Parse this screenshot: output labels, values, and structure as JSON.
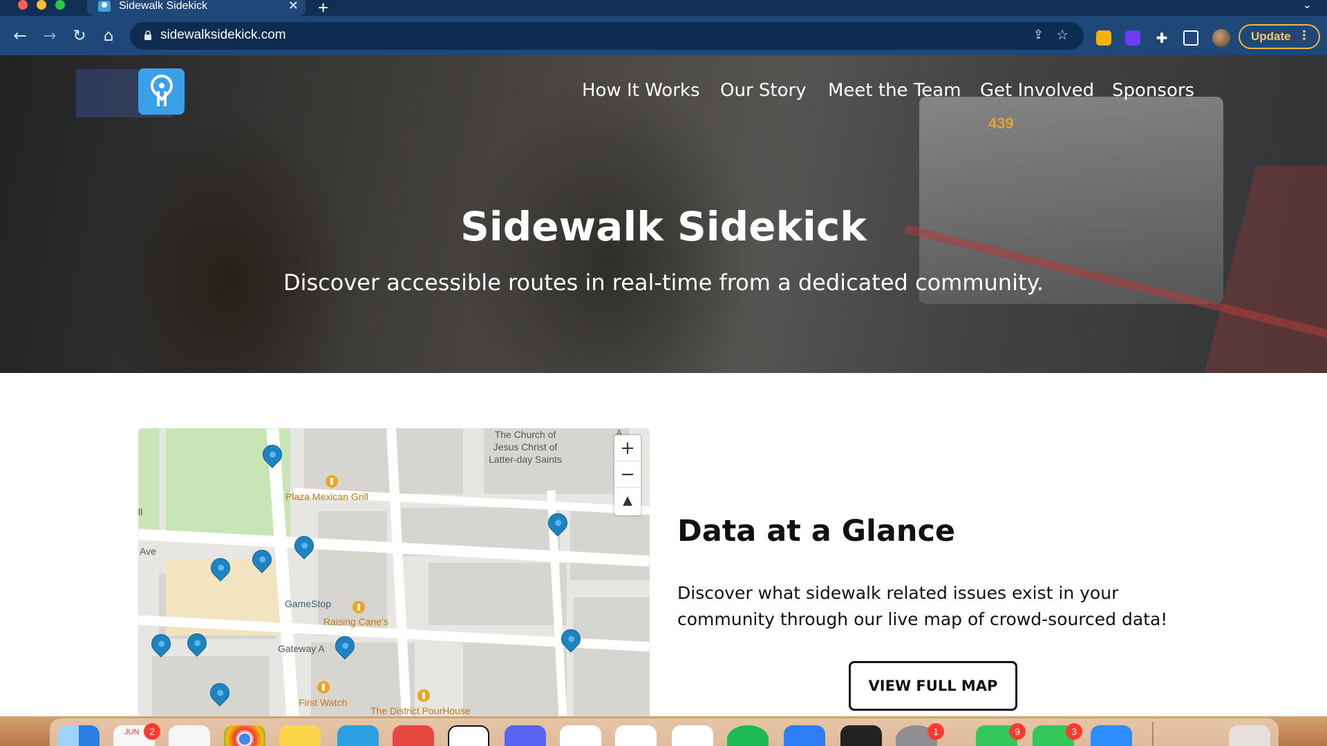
{
  "browser": {
    "tab_title": "Sidewalk Sidekick",
    "tab_close": "✕",
    "new_tab": "+",
    "url": "sidewalksidekick.com",
    "update_label": "Update",
    "update_menu": "⋮"
  },
  "site": {
    "nav": [
      "How It Works",
      "Our Story",
      "Meet the Team",
      "Get Involved",
      "Sponsors"
    ],
    "hero_title": "Sidewalk Sidekick",
    "hero_subtitle": "Discover accessible routes in real-time from a dedicated community.",
    "hero_bus_number": "439"
  },
  "map": {
    "labels": {
      "church": "The Church of\nJesus Christ of\nLatter-day Saints",
      "plaza": "Plaza Mexican Grill",
      "ave": "Ave",
      "gamestop": "GameStop",
      "raising": "Raising Cane's",
      "gateway": "Gateway A",
      "firstwatch": "First Watch",
      "pourhouse": "The District PourHouse",
      "ll": "ll"
    },
    "controls": {
      "zoom_in": "+",
      "zoom_out": "−",
      "compass": "▲"
    },
    "attribution": "A"
  },
  "data_section": {
    "title": "Data at a Glance",
    "description": "Discover what sidewalk related issues exist in your community through our live map of crowd-sourced data!",
    "button": "VIEW FULL MAP"
  },
  "dock": {
    "calendar_month": "JUN",
    "badges": {
      "calendar": "2",
      "settings": "1",
      "facetime": "9",
      "messages": "3"
    }
  },
  "colors": {
    "browser_frame": "#1f4777",
    "brand_blue": "#3aa0e8",
    "map_marker": "#1e83c1",
    "update_accent": "#f2b93b"
  }
}
